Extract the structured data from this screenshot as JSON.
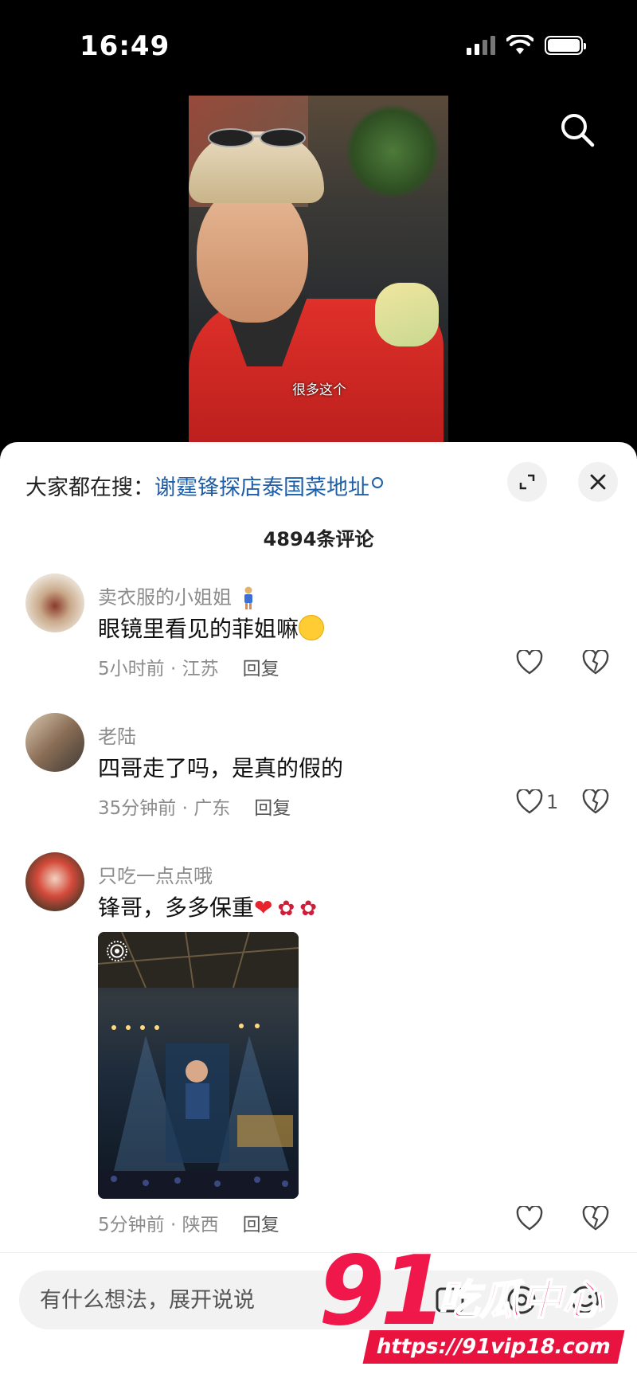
{
  "status_bar": {
    "time": "16:49"
  },
  "video": {
    "subtitle": "很多这个"
  },
  "hot_search": {
    "prefix": "大家都在搜：",
    "term": "谢霆锋探店泰国菜地址"
  },
  "comment_count": "4894条评论",
  "comments": [
    {
      "user": "卖衣服的小姐姐",
      "text": "眼镜里看见的菲姐嘛",
      "meta": "5小时前 · 江苏",
      "reply": "回复",
      "likes": ""
    },
    {
      "user": "老陆",
      "text": "四哥走了吗，是真的假的",
      "meta": "35分钟前 · 广东",
      "reply": "回复",
      "likes": "1"
    },
    {
      "user": "只吃一点点哦",
      "text": "锋哥，多多保重",
      "meta": "5分钟前 · 陕西",
      "reply": "回复",
      "likes": ""
    }
  ],
  "input": {
    "placeholder": "有什么想法，展开说说"
  },
  "watermark": {
    "logo": "91",
    "name": "吃瓜中心",
    "url": "https://91vip18.com"
  },
  "icons": {
    "search": "search-icon",
    "expand": "expand-icon",
    "close": "close-icon",
    "like": "heart-outline-icon",
    "dislike": "broken-heart-icon"
  }
}
